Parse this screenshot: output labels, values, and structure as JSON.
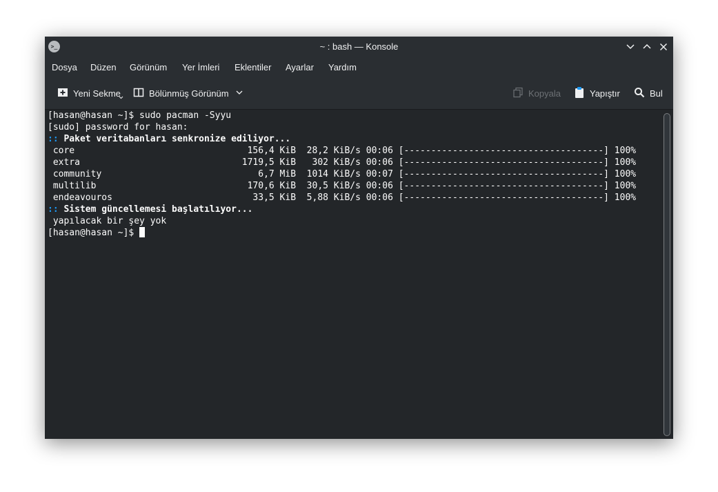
{
  "window": {
    "title": "~ : bash — Konsole"
  },
  "menu": [
    "Dosya",
    "Düzen",
    "Görünüm",
    "Yer İmleri",
    "Eklentiler",
    "Ayarlar",
    "Yardım"
  ],
  "toolbar": {
    "new_tab": "Yeni Sekme",
    "split_view": "Bölünmüş Görünüm",
    "copy": "Kopyala",
    "paste": "Yapıştır",
    "find": "Bul"
  },
  "terminal": {
    "line1": "[hasan@hasan ~]$ sudo pacman -Syyu",
    "line2": "[sudo] password for hasan:",
    "sync_marker": "::",
    "sync_text": "Paket veritabanları senkronize ediliyor...",
    "repos": [
      " core                                156,4 KiB  28,2 KiB/s 00:06 [-------------------------------------] 100%",
      " extra                              1719,5 KiB   302 KiB/s 00:06 [-------------------------------------] 100%",
      " community                             6,7 MiB  1014 KiB/s 00:07 [-------------------------------------] 100%",
      " multilib                            170,6 KiB  30,5 KiB/s 00:06 [-------------------------------------] 100%",
      " endeavouros                          33,5 KiB  5,88 KiB/s 00:06 [-------------------------------------] 100%"
    ],
    "upgrade_marker": "::",
    "upgrade_text": "Sistem güncellemesi başlatılıyor...",
    "nothing_text": " yapılacak bir şey yok",
    "prompt": "[hasan@hasan ~]$ "
  },
  "colors": {
    "accent": "#1d99f3",
    "background": "#232629",
    "chrome": "#2a2e32"
  },
  "icons": [
    "konsole-icon",
    "minimize-icon",
    "maximize-icon",
    "close-icon",
    "new-tab-icon",
    "split-view-icon",
    "copy-icon",
    "paste-icon",
    "search-icon"
  ]
}
